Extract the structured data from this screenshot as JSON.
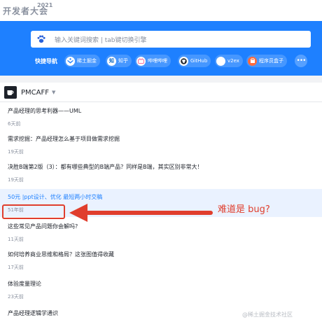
{
  "header": {
    "logo_text": "开发者大会",
    "logo_year": "2021"
  },
  "search": {
    "placeholder": "输入关键词搜索 | tab键切换引擎"
  },
  "quicknav": {
    "title": "快捷导航",
    "items": [
      {
        "label": "稀土掘金",
        "icon": "juejin-icon",
        "color": "#1e80ff"
      },
      {
        "label": "知乎",
        "icon": "zhihu-icon",
        "color": "#0a66c2"
      },
      {
        "label": "哔哩哔哩",
        "icon": "bilibili-icon",
        "color": "#fb7299"
      },
      {
        "label": "GitHub",
        "icon": "github-icon",
        "color": "#24292f"
      },
      {
        "label": "v2ex",
        "icon": "v2ex-icon",
        "color": "#ffffff"
      },
      {
        "label": "程序员盒子",
        "icon": "box-icon",
        "color": "#ff6b3d"
      }
    ],
    "more_icon": "more-dots-icon"
  },
  "feed": {
    "source": "PMCAFF",
    "items": [
      {
        "title": "产品经理的思考利器——UML",
        "time": "6天前"
      },
      {
        "title": "需求挖掘：产品经理怎么基于项目做需求挖掘",
        "time": "19天前"
      },
      {
        "title": "决胜B端第2版（3）：都有哪些典型的B端产品？同样是B端，其实区别非常大！",
        "time": "19天前"
      },
      {
        "title": "50元 |ppt设计、优化 最短两小时交稿",
        "time": "51年前",
        "ad": true
      },
      {
        "title": "这些常见产品问题你会解吗?",
        "time": "11天前"
      },
      {
        "title": "如何培养商业思维和格局？这张图值得收藏",
        "time": "17天前"
      },
      {
        "title": "体验度量理论",
        "time": "23天前"
      },
      {
        "title": "产品经理逻辑学通识",
        "time": ""
      }
    ]
  },
  "annotation": {
    "note": "难道是 bug?",
    "color": "#e03e2d"
  },
  "watermark": "@稀土掘金技术社区",
  "colors": {
    "brand_blue": "#1e80ff",
    "ad_background": "#eaf2ff"
  }
}
